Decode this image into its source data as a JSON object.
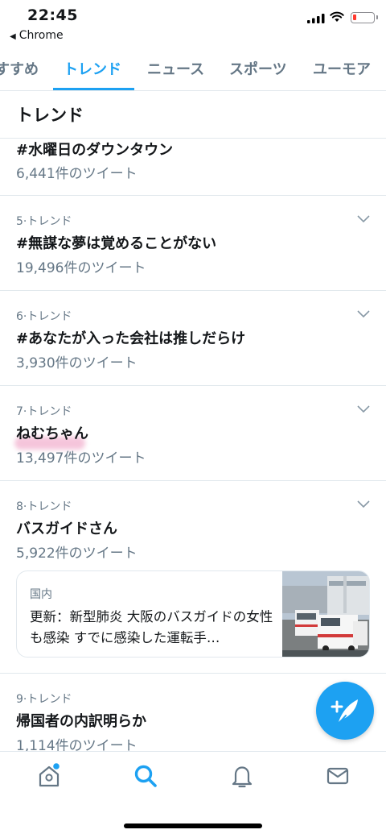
{
  "status_bar": {
    "time": "22:45",
    "back_label": "Chrome"
  },
  "tabs": [
    {
      "label": "すすめ",
      "active": false
    },
    {
      "label": "トレンド",
      "active": true
    },
    {
      "label": "ニュース",
      "active": false
    },
    {
      "label": "スポーツ",
      "active": false
    },
    {
      "label": "ユーモア",
      "active": false
    }
  ],
  "section_title": "トレンド",
  "trends": [
    {
      "rank": "",
      "name": "#水曜日のダウンタウン",
      "count": "6,441件のツイート"
    },
    {
      "rank": "5·トレンド",
      "name": "#無謀な夢は覚めることがない",
      "count": "19,496件のツイート"
    },
    {
      "rank": "6·トレンド",
      "name": "#あなたが入った会社は推しだらけ",
      "count": "3,930件のツイート"
    },
    {
      "rank": "7·トレンド",
      "name": "ねむちゃん",
      "count": "13,497件のツイート"
    },
    {
      "rank": "8·トレンド",
      "name": "バスガイドさん",
      "count": "5,922件のツイート"
    },
    {
      "rank": "9·トレンド",
      "name": "帰国者の内訳明らか",
      "count": "1,114件のツイート"
    }
  ],
  "news_card": {
    "category": "国内",
    "headline": "更新：新型肺炎 大阪のバスガイドの女性も感染 すでに感染した運転手…"
  },
  "colors": {
    "accent": "#1da1f2",
    "secondary_text": "#657786",
    "divider": "#e1e8ed",
    "highlight": "#ec96be"
  },
  "icons": [
    "home-icon",
    "search-icon",
    "notifications-bell-icon",
    "messages-envelope-icon",
    "compose-tweet-icon",
    "chevron-down-icon"
  ]
}
